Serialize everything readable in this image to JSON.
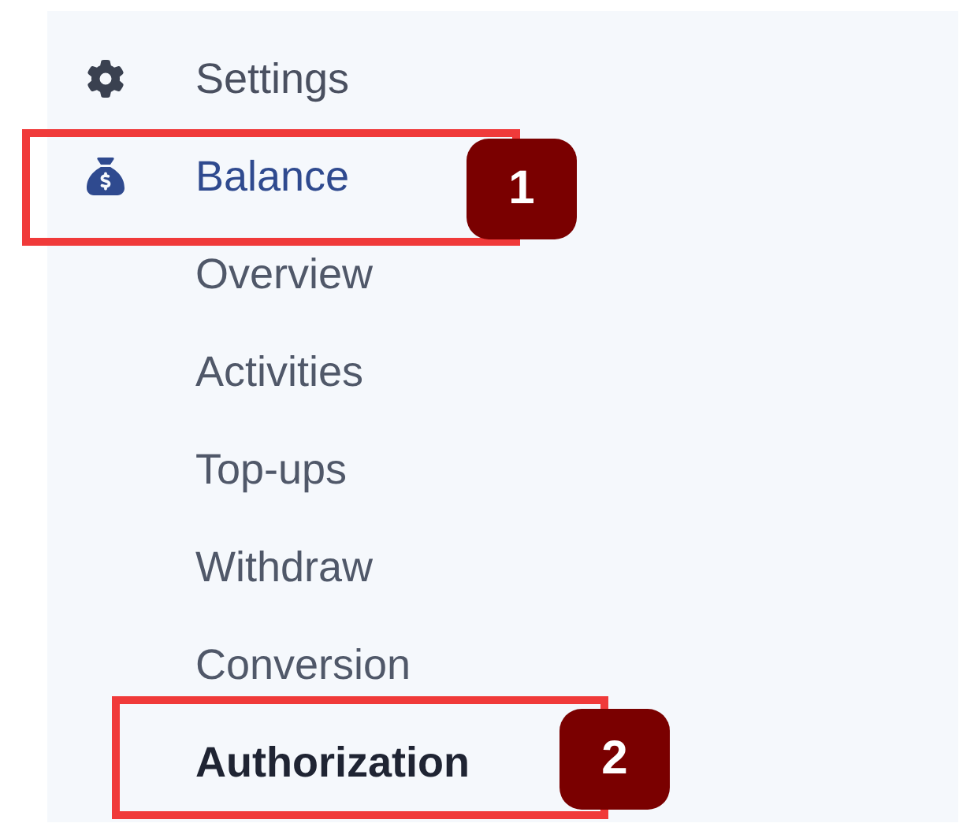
{
  "sidebar": {
    "items": [
      {
        "kind": "section",
        "label": "Settings",
        "selected": false
      },
      {
        "kind": "section",
        "label": "Balance",
        "selected": true,
        "callout": "1"
      },
      {
        "kind": "sub",
        "label": "Overview",
        "selected": false
      },
      {
        "kind": "sub",
        "label": "Activities",
        "selected": false
      },
      {
        "kind": "sub",
        "label": "Top-ups",
        "selected": false
      },
      {
        "kind": "sub",
        "label": "Withdraw",
        "selected": false
      },
      {
        "kind": "sub",
        "label": "Conversion",
        "selected": false
      },
      {
        "kind": "sub",
        "label": "Authorization",
        "selected": true,
        "callout": "2"
      }
    ]
  }
}
